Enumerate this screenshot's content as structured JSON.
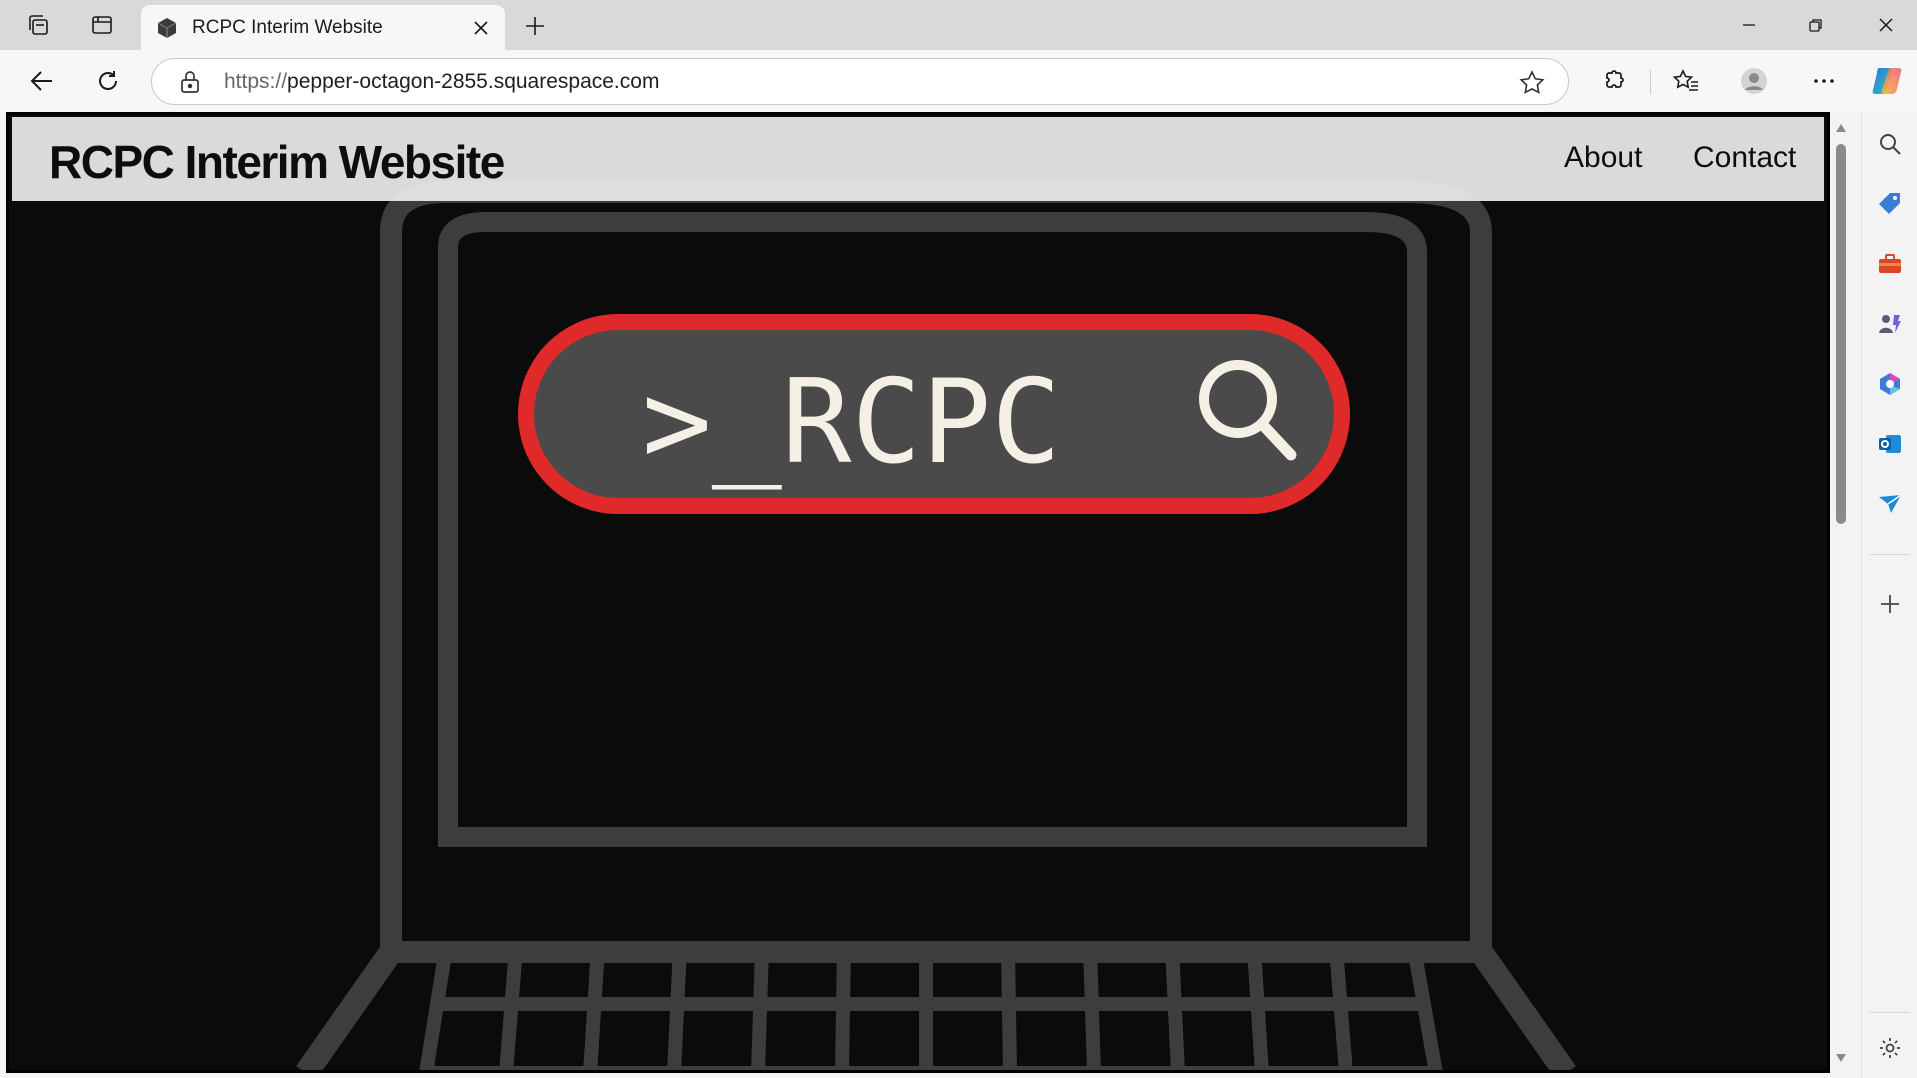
{
  "browser": {
    "tab": {
      "title": "RCPC Interim Website",
      "favicon": "cube-icon"
    },
    "address": {
      "scheme": "https://",
      "host": "pepper-octagon-2855.squarespace.com"
    },
    "icons": {
      "workspaces": "workspaces-icon",
      "tab_actions": "tab-actions-icon",
      "close_tab": "close-icon",
      "new_tab": "plus-icon",
      "back": "back-arrow-icon",
      "refresh": "refresh-icon",
      "lock": "lock-icon",
      "favorite": "star-icon",
      "extensions": "puzzle-icon",
      "favorites": "favorites-icon",
      "profile": "profile-icon",
      "more": "more-icon",
      "copilot": "copilot-icon"
    }
  },
  "site": {
    "title": "RCPC Interim Website",
    "nav": [
      "About",
      "Contact"
    ],
    "hero": {
      "badge_text": ">_RCPC",
      "badge_icon": "search-icon",
      "colors": {
        "badge_border": "#e02a2a",
        "badge_fill": "#4a4a4a",
        "outline": "#3a3a3a",
        "background": "#0b0b0b"
      }
    }
  },
  "sidebar": {
    "items": [
      "search-icon",
      "tag-icon",
      "briefcase-icon",
      "games-icon",
      "m365-icon",
      "outlook-icon",
      "send-icon"
    ],
    "add": "plus-icon",
    "settings": "gear-icon"
  }
}
